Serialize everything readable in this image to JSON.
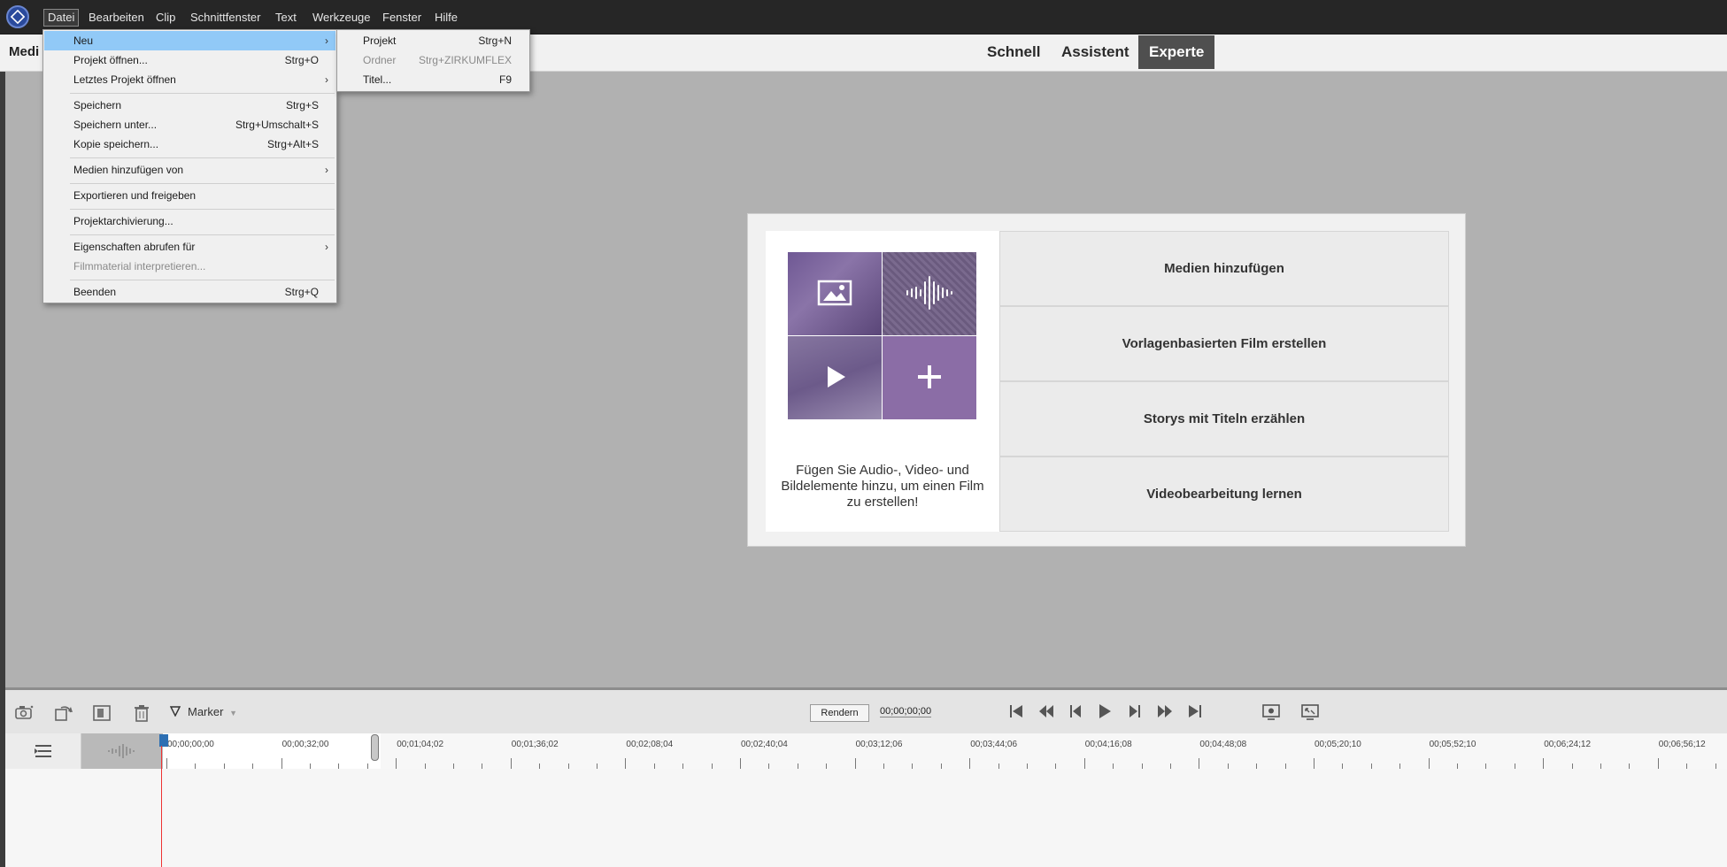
{
  "menubar": {
    "items": [
      "Datei",
      "Bearbeiten",
      "Clip",
      "Schnittfenster",
      "Text",
      "Werkzeuge",
      "Fenster",
      "Hilfe"
    ]
  },
  "header": {
    "left_label": "Medi",
    "modes": [
      "Schnell",
      "Assistent",
      "Experte"
    ],
    "active_mode": "Experte"
  },
  "file_menu": {
    "items": [
      {
        "label": "Neu",
        "shortcut": "",
        "submenu": true
      },
      {
        "label": "Projekt öffnen...",
        "shortcut": "Strg+O"
      },
      {
        "label": "Letztes Projekt öffnen",
        "shortcut": "",
        "submenu": true
      },
      {
        "label": "Speichern",
        "shortcut": "Strg+S"
      },
      {
        "label": "Speichern unter...",
        "shortcut": "Strg+Umschalt+S"
      },
      {
        "label": "Kopie speichern...",
        "shortcut": "Strg+Alt+S"
      },
      {
        "label": "Medien hinzufügen von",
        "shortcut": "",
        "submenu": true
      },
      {
        "label": "Exportieren und freigeben",
        "shortcut": ""
      },
      {
        "label": "Projektarchivierung...",
        "shortcut": ""
      },
      {
        "label": "Eigenschaften abrufen für",
        "shortcut": "",
        "submenu": true
      },
      {
        "label": "Filmmaterial interpretieren...",
        "shortcut": "",
        "disabled": true
      },
      {
        "label": "Beenden",
        "shortcut": "Strg+Q"
      }
    ]
  },
  "new_submenu": {
    "items": [
      {
        "label": "Projekt",
        "shortcut": "Strg+N"
      },
      {
        "label": "Ordner",
        "shortcut": "Strg+ZIRKUMFLEX",
        "disabled": true
      },
      {
        "label": "Titel...",
        "shortcut": "F9"
      }
    ]
  },
  "welcome": {
    "description": "Fügen Sie Audio-, Video- und Bildelemente hinzu, um einen Film zu erstellen!",
    "options": [
      "Medien hinzufügen",
      "Vorlagenbasierten Film erstellen",
      "Storys mit Titeln erzählen",
      "Videobearbeitung lernen"
    ]
  },
  "timeline": {
    "marker_label": "Marker",
    "render_label": "Rendern",
    "timecode": "00;00;00;00",
    "ruler_labels": [
      "00;00;00;00",
      "00;00;32;00",
      "00;01;04;02",
      "00;01;36;02",
      "00;02;08;04",
      "00;02;40;04",
      "00;03;12;06",
      "00;03;44;06",
      "00;04;16;08",
      "00;04;48;08",
      "00;05;20;10",
      "00;05;52;10",
      "00;06;24;12",
      "00;06;56;12"
    ]
  },
  "icons": [
    "app-logo-icon",
    "camera-icon",
    "rotate-icon",
    "smart-fix-icon",
    "trash-icon",
    "marker-icon",
    "goto-start-icon",
    "rewind-icon",
    "step-back-icon",
    "play-icon",
    "step-forward-icon",
    "fast-forward-icon",
    "goto-end-icon",
    "render-settings-icon",
    "fullscreen-icon",
    "track-settings-icon",
    "audio-wave-icon"
  ],
  "colors": {
    "menu_highlight": "#91c9f7",
    "active_mode_bg": "#4f4f4f",
    "playhead": "#ee3333",
    "tile_purple": "#8b6da6"
  }
}
